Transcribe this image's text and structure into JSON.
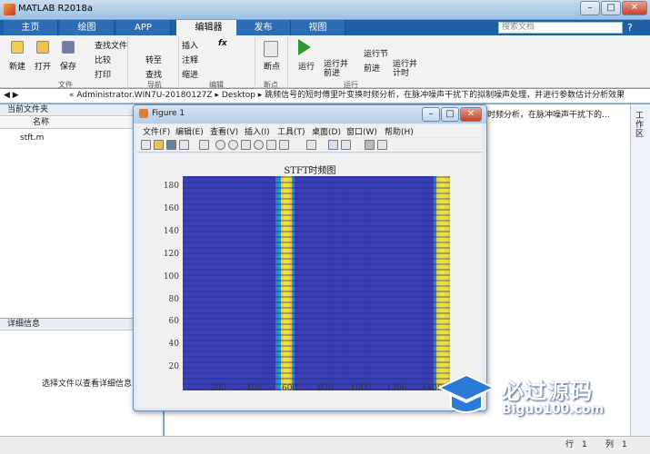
{
  "window": {
    "title": "MATLAB R2018a",
    "controls": [
      "–",
      "□",
      "✕"
    ]
  },
  "ribbon_tabs": [
    "主页",
    "绘图",
    "APP",
    "编辑器",
    "发布",
    "视图"
  ],
  "search_placeholder": "搜索文档",
  "ribbon": {
    "file": {
      "new": "新建",
      "open": "打开",
      "save": "保存",
      "find_files": "查找文件",
      "compare": "比较",
      "print": "打印",
      "group": "文件"
    },
    "nav": {
      "goto": "转至",
      "find": "查找",
      "group": "导航"
    },
    "edit": {
      "insert": "插入",
      "comment": "注释",
      "indent": "缩进",
      "fx": "fx",
      "group": "编辑"
    },
    "breakpoints": {
      "label": "断点",
      "group": "断点"
    },
    "run": {
      "run": "运行",
      "run_advance": "运行并\n前进",
      "run_section": "运行节",
      "advance": "前进",
      "run_time": "运行并\n计时",
      "group": "运行"
    }
  },
  "address": {
    "path": "«  Administrator.WIN7U-20180127Z  ▸  Desktop  ▸  跳频信号的短时傅里叶变换时频分析，在脉冲噪声干扰下的拟制噪声处理，并进行参数估计分析效果"
  },
  "current_folder": {
    "header": "当前文件夹",
    "col_name": "名称",
    "file": "stft.m"
  },
  "details": {
    "header": "详细信息",
    "empty_msg": "选择文件以查看详细信息"
  },
  "cmd_trunc": "时频分析，在脉冲噪声干扰下的...",
  "right_strip_label": "工作区",
  "status": {
    "row_label": "行",
    "row": "1",
    "col_label": "列",
    "col": "1"
  },
  "figure": {
    "title": "Figure 1",
    "menu": [
      "文件(F)",
      "编辑(E)",
      "查看(V)",
      "插入(I)",
      "工具(T)",
      "桌面(D)",
      "窗口(W)",
      "帮助(H)"
    ]
  },
  "chart_data": {
    "type": "heatmap",
    "title": "STFT时频图",
    "xlim": [
      0,
      1500
    ],
    "ylim": [
      0,
      190
    ],
    "xticks": [
      200,
      400,
      600,
      800,
      1000,
      1200,
      1400
    ],
    "yticks": [
      20,
      40,
      60,
      80,
      100,
      120,
      140,
      160,
      180
    ],
    "colormap": "parula",
    "high_energy_columns": [
      580,
      1460
    ],
    "colors": {
      "low": "#3b3fb2",
      "mid": "#22a0d0",
      "high": "#f0e040"
    }
  },
  "watermark": {
    "cn": "必过源码",
    "url": "Biguo100.com"
  }
}
